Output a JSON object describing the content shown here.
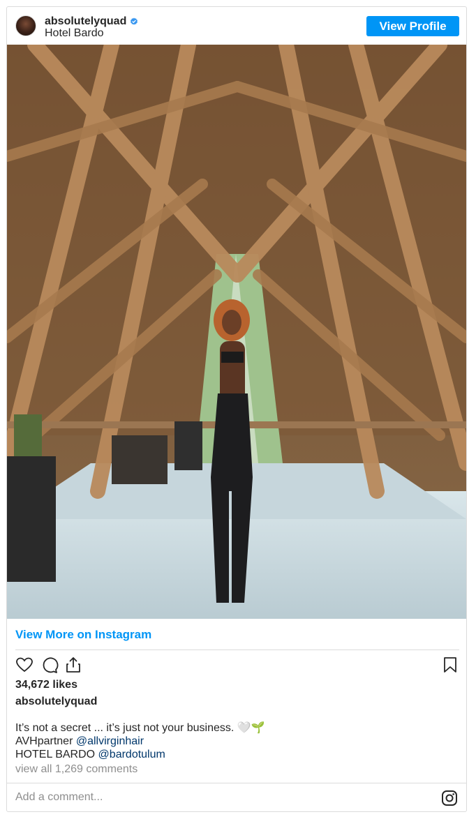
{
  "header": {
    "username": "absolutelyquad",
    "location": "Hotel Bardo",
    "view_profile_label": "View Profile",
    "verified_color": "#3897f0"
  },
  "post": {
    "view_more_label": "View More on Instagram",
    "likes": "34,672 likes",
    "owner": "absolutelyquad",
    "caption_line1": "It’s not a secret ... it’s just not your business. 🤍🌱",
    "caption_line2_prefix": "AVHpartner ",
    "caption_line2_mention": "@allvirginhair",
    "caption_line3_prefix": "HOTEL BARDO ",
    "caption_line3_mention": "@bardotulum",
    "comments_link": "view all 1,269 comments",
    "icons": [
      "heart-icon",
      "comment-icon",
      "share-icon",
      "bookmark-icon",
      "instagram-icon"
    ]
  },
  "comment_box": {
    "placeholder": "Add a comment..."
  },
  "colors": {
    "accent": "#0095f6",
    "link": "#00376b",
    "muted": "#8e8e8e"
  }
}
